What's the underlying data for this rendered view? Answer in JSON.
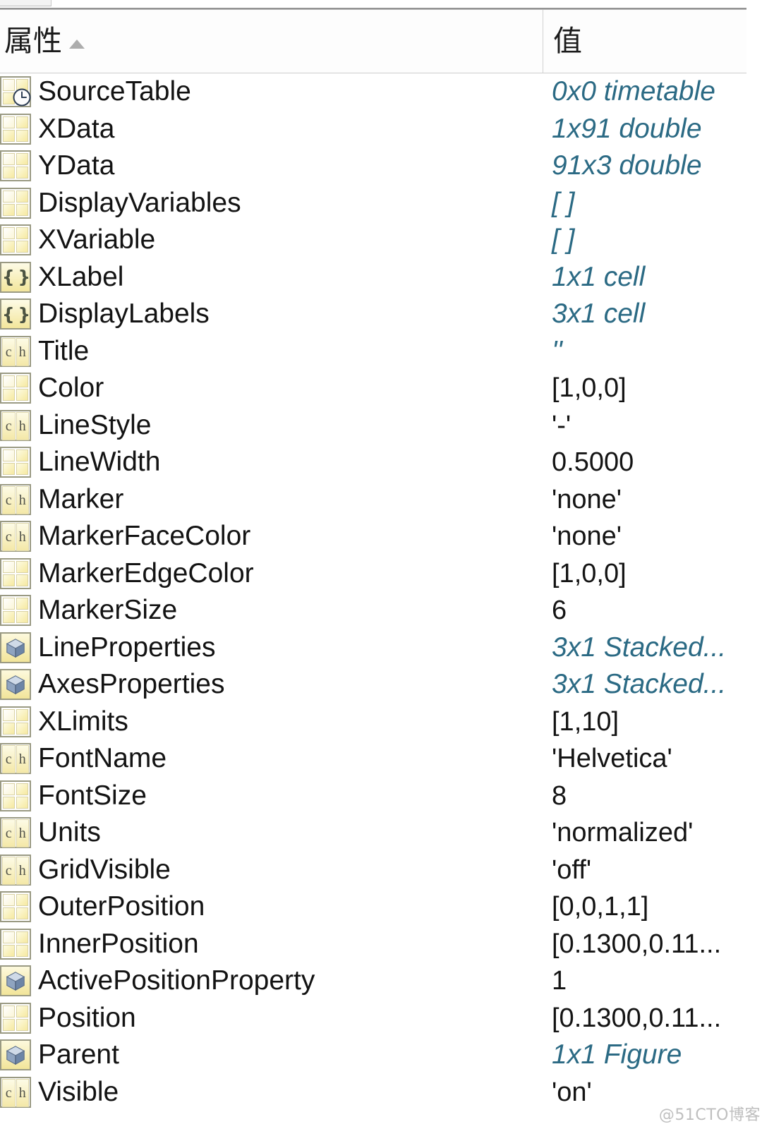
{
  "window": {
    "top_tab_present": true
  },
  "table": {
    "columns": [
      {
        "key": "property",
        "label": "属性",
        "sort": "ascending",
        "sort_glyph": "▲"
      },
      {
        "key": "value",
        "label": "值",
        "sort": "none"
      }
    ],
    "rows": [
      {
        "icon": "timetable-icon",
        "name": "SourceTable",
        "value": "0x0 timetable",
        "value_style": "link"
      },
      {
        "icon": "matrix-icon",
        "name": "XData",
        "value": "1x91 double",
        "value_style": "link"
      },
      {
        "icon": "matrix-icon",
        "name": "YData",
        "value": "91x3 double",
        "value_style": "link"
      },
      {
        "icon": "matrix-icon",
        "name": "DisplayVariables",
        "value": "[ ]",
        "value_style": "link"
      },
      {
        "icon": "matrix-icon",
        "name": "XVariable",
        "value": "[ ]",
        "value_style": "link"
      },
      {
        "icon": "cell-icon",
        "name": "XLabel",
        "value": "1x1 cell",
        "value_style": "link"
      },
      {
        "icon": "cell-icon",
        "name": "DisplayLabels",
        "value": "3x1 cell",
        "value_style": "link"
      },
      {
        "icon": "char-icon",
        "name": "Title",
        "value": "''",
        "value_style": "link"
      },
      {
        "icon": "matrix-icon",
        "name": "Color",
        "value": "[1,0,0]",
        "value_style": "plain"
      },
      {
        "icon": "char-icon",
        "name": "LineStyle",
        "value": "'-'",
        "value_style": "plain"
      },
      {
        "icon": "matrix-icon",
        "name": "LineWidth",
        "value": "0.5000",
        "value_style": "plain"
      },
      {
        "icon": "char-icon",
        "name": "Marker",
        "value": "'none'",
        "value_style": "plain"
      },
      {
        "icon": "char-icon",
        "name": "MarkerFaceColor",
        "value": "'none'",
        "value_style": "plain"
      },
      {
        "icon": "matrix-icon",
        "name": "MarkerEdgeColor",
        "value": "[1,0,0]",
        "value_style": "plain"
      },
      {
        "icon": "matrix-icon",
        "name": "MarkerSize",
        "value": "6",
        "value_style": "plain"
      },
      {
        "icon": "object-icon",
        "name": "LineProperties",
        "value": "3x1 Stacked...",
        "value_style": "link"
      },
      {
        "icon": "object-icon",
        "name": "AxesProperties",
        "value": "3x1 Stacked...",
        "value_style": "link"
      },
      {
        "icon": "matrix-icon",
        "name": "XLimits",
        "value": "[1,10]",
        "value_style": "plain"
      },
      {
        "icon": "char-icon",
        "name": "FontName",
        "value": "'Helvetica'",
        "value_style": "plain"
      },
      {
        "icon": "matrix-icon",
        "name": "FontSize",
        "value": "8",
        "value_style": "plain"
      },
      {
        "icon": "char-icon",
        "name": "Units",
        "value": "'normalized'",
        "value_style": "plain"
      },
      {
        "icon": "char-icon",
        "name": "GridVisible",
        "value": "'off'",
        "value_style": "plain"
      },
      {
        "icon": "matrix-icon",
        "name": "OuterPosition",
        "value": "[0,0,1,1]",
        "value_style": "plain"
      },
      {
        "icon": "matrix-icon",
        "name": "InnerPosition",
        "value": "[0.1300,0.11...",
        "value_style": "plain"
      },
      {
        "icon": "object-icon",
        "name": "ActivePositionProperty",
        "value": "1",
        "value_style": "plain"
      },
      {
        "icon": "matrix-icon",
        "name": "Position",
        "value": "[0.1300,0.11...",
        "value_style": "plain"
      },
      {
        "icon": "object-icon",
        "name": "Parent",
        "value": "1x1 Figure",
        "value_style": "link"
      },
      {
        "icon": "char-icon",
        "name": "Visible",
        "value": "'on'",
        "value_style": "plain"
      }
    ]
  },
  "watermark": {
    "text": "@51CTO博客"
  },
  "colors": {
    "link_value": "#2b6a84",
    "plain_value": "#141414",
    "property_text": "#131313",
    "header_text": "#1b1b1b",
    "icon_yellow": "#f3e69c",
    "icon_border": "#9a9a83",
    "cube_blue": "#93a9c6",
    "grid_line": "#cdcdcd",
    "background": "#ffffff"
  }
}
